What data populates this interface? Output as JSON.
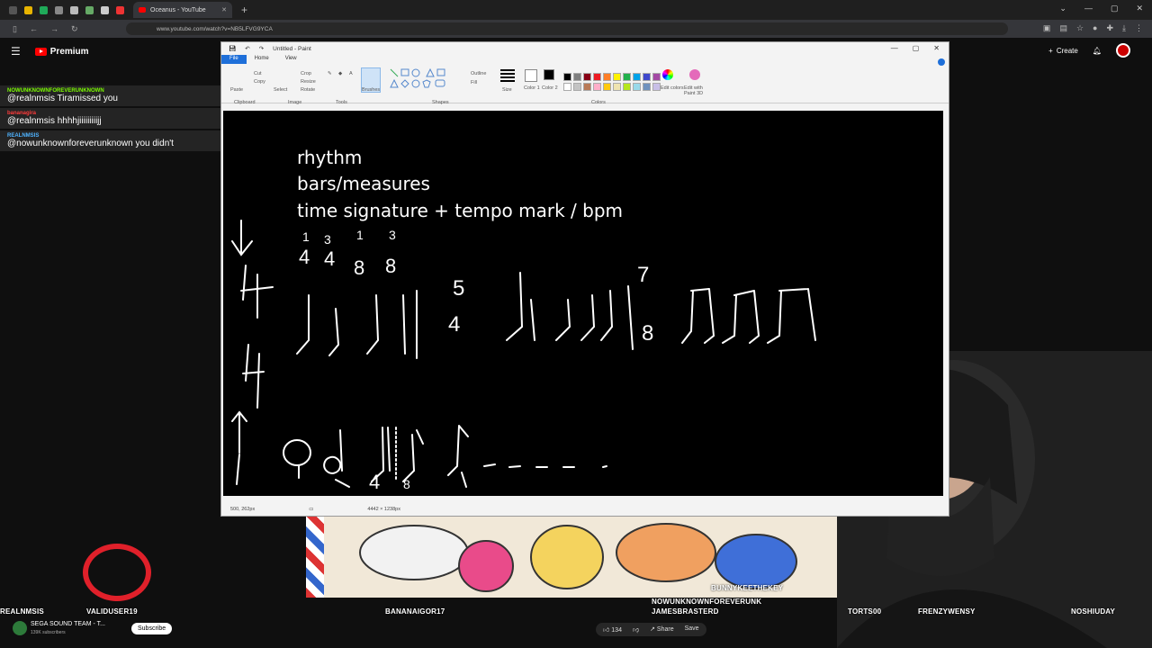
{
  "browser": {
    "tab_title": "Oceanus - YouTube",
    "url": "www.youtube.com/watch?v=NB5LFVG9YCA",
    "new_tab": "+"
  },
  "youtube": {
    "brand": "Premium",
    "create_label": "Create"
  },
  "chat": [
    {
      "user": "NOWUNKNOWNFOREVERUNKNOWN",
      "user_color": "#7CFC00",
      "text": "@realnmsis Tiramissed you"
    },
    {
      "user": "bananagira",
      "user_color": "#ff3b3b",
      "text": "@realnmsis hhhhjiiiiiiiiijj"
    },
    {
      "user": "REALNMSIS",
      "user_color": "#4fb3ff",
      "text": "@nowunknownforeverunknown you didn't"
    }
  ],
  "paint": {
    "title": "Untitled - Paint",
    "tabs": [
      "File",
      "Home",
      "View"
    ],
    "ribbon_groups": [
      "Clipboard",
      "Image",
      "Tools",
      "Shapes",
      "Colors"
    ],
    "ribbon_labels": {
      "brushes": "Brushes",
      "size": "Size",
      "color1": "Color 1",
      "color2": "Color 2",
      "edit_colors": "Edit colors",
      "edit_paint3d": "Edit with Paint 3D",
      "outline": "Outline",
      "fill": "Fill",
      "crop": "Crop",
      "resize": "Resize",
      "rotate": "Rotate",
      "select": "Select",
      "paste": "Paste",
      "cut": "Cut",
      "copy": "Copy"
    },
    "palette": [
      "#000000",
      "#7f7f7f",
      "#880015",
      "#ed1c24",
      "#ff7f27",
      "#fff200",
      "#22b14c",
      "#00a2e8",
      "#3f48cc",
      "#a349a4",
      "#ffffff",
      "#c3c3c3",
      "#b97a57",
      "#ffaec9",
      "#ffc90e",
      "#efe4b0",
      "#b5e61d",
      "#99d9ea",
      "#7092be",
      "#c8bfe7"
    ],
    "canvas_text": [
      "rhythm",
      "bars/measures",
      "time signature + tempo mark / bpm"
    ],
    "status_position": "500, 262px",
    "status_size": "4442 × 1238px"
  },
  "bottom": {
    "names": [
      "REALNMSIS",
      "VALIDUSER19",
      "BANANAIGOR17",
      "NOWUNKNOWNFOREVERUNK",
      "JAMESBRASTERD",
      "BUNNYKEETHEKEY",
      "TORTS00",
      "FRENZYWENSY",
      "NOSHIUDAY"
    ],
    "channel": "SEGA SOUND TEAM - T...",
    "channel_subs": "139K subscribers",
    "subscribe": "Subscribe",
    "likes": "134",
    "share": "Share",
    "save": "Save"
  }
}
